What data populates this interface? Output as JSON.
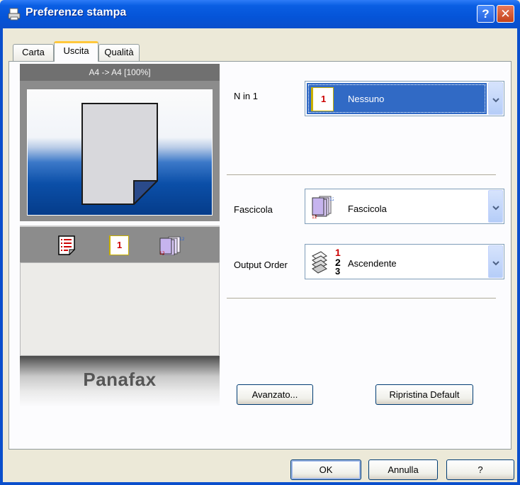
{
  "window": {
    "title": "Preferenze stampa",
    "help_glyph": "?",
    "close_glyph": "✕"
  },
  "tabs": [
    {
      "label": "Carta"
    },
    {
      "label": "Uscita"
    },
    {
      "label": "Qualità"
    }
  ],
  "preview": {
    "header": "A4 -> A4 [100%]",
    "brand": "Panafax",
    "icon_page_number": "1"
  },
  "nin1": {
    "label": "N in 1",
    "value": "Nessuno",
    "icon_number": "1"
  },
  "collate": {
    "label": "Fascicola",
    "value": "Fascicola"
  },
  "output_order": {
    "label": "Output Order",
    "value": "Ascendente",
    "icon_digits": [
      "1",
      "2",
      "3"
    ]
  },
  "buttons": {
    "advanced": "Avanzato...",
    "restore": "Ripristina Default",
    "ok": "OK",
    "cancel": "Annulla",
    "help": "?"
  },
  "colors": {
    "titlebar": "#0554d8",
    "selection": "#316ac5",
    "dialog_bg": "#ece9d8"
  }
}
